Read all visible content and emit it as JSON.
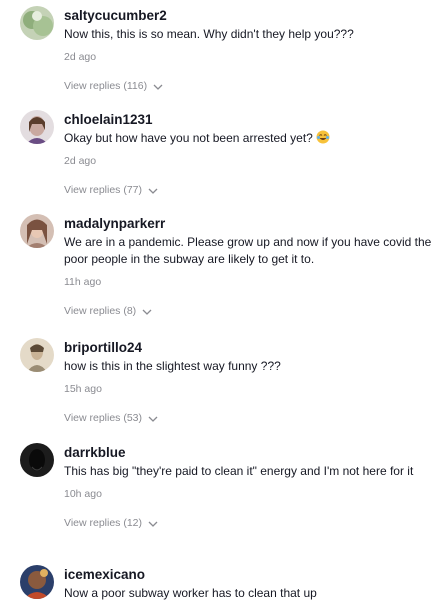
{
  "comments": [
    {
      "username": "saltycucumber2",
      "text": "Now this, this is so mean. Why didn't they help you???",
      "time": "2d ago",
      "replies": "View replies (116)",
      "avatar_colors": [
        "#b8c9a8",
        "#6f8f5f"
      ]
    },
    {
      "username": "chloelain1231",
      "text": "Okay but how have you not been arrested yet?",
      "emoji": "laughing-tears",
      "time": "2d ago",
      "replies": "View replies (77)",
      "avatar_colors": [
        "#d9d2d4",
        "#7a5a8a"
      ]
    },
    {
      "username": "madalynparkerr",
      "text": "We are in a pandemic. Please grow up and now if you have covid the poor people in the subway are likely to get it to.",
      "time": "11h ago",
      "replies": "View replies (8)",
      "avatar_colors": [
        "#c7a89a",
        "#8a6a5c"
      ]
    },
    {
      "username": "briportillo24",
      "text": "how is this in the slightest way funny ???",
      "time": "15h ago",
      "replies": "View replies (53)",
      "avatar_colors": [
        "#d8cdb8",
        "#8f8470"
      ]
    },
    {
      "username": "darrkblue",
      "text": "This has big \"they're paid to clean it\" energy and I'm not here for it",
      "time": "10h ago",
      "replies": "View replies (12)",
      "avatar_colors": [
        "#2a2a2a",
        "#111111"
      ]
    },
    {
      "username": "icemexicano",
      "text": "Now a poor subway worker has to clean that up",
      "time": "",
      "replies": "",
      "avatar_colors": [
        "#7a4a3a",
        "#2b3f6a"
      ]
    }
  ]
}
